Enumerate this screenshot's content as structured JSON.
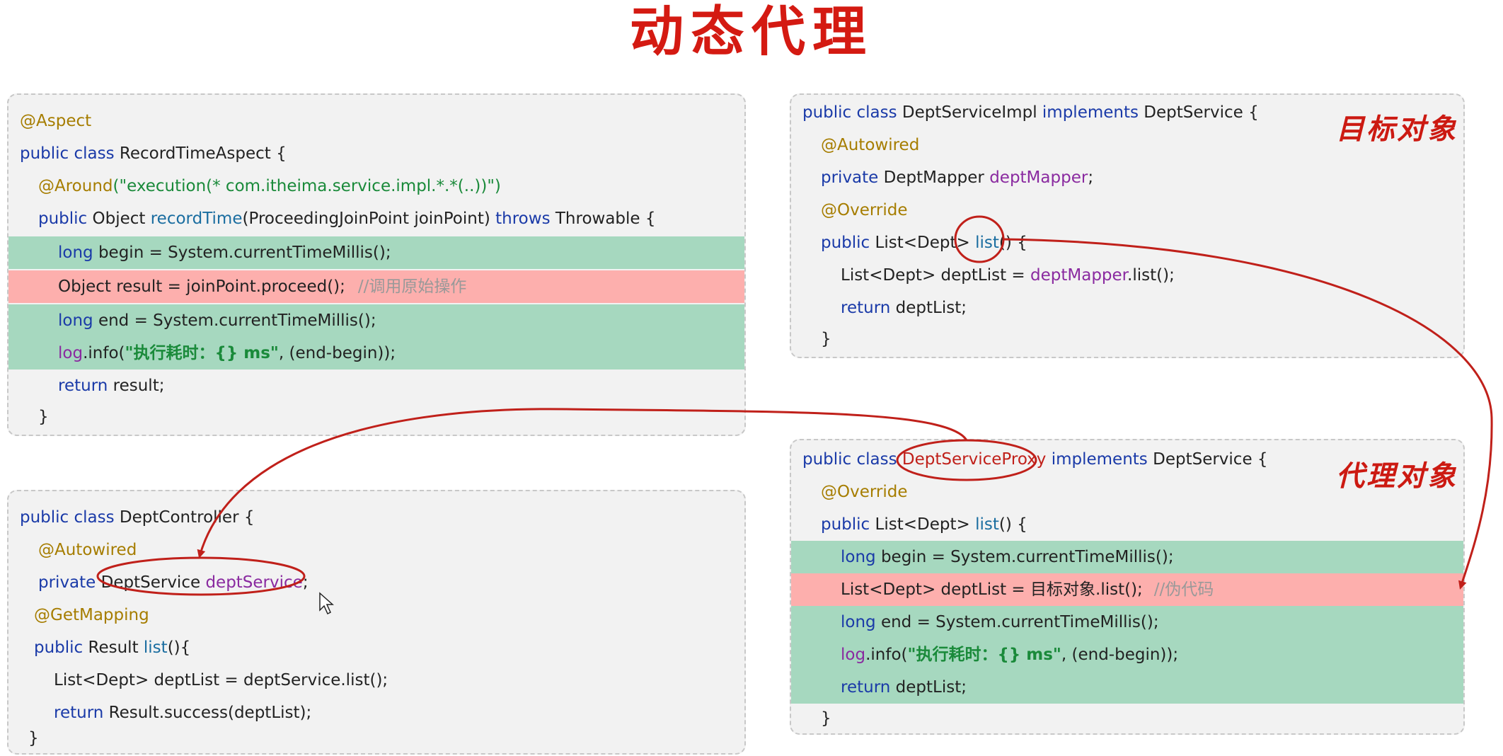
{
  "title": "动态代理",
  "aspect": {
    "line1": "@Aspect",
    "line2_kw": "public class ",
    "line2_name": "RecordTimeAspect {",
    "line3_ann": "@Around",
    "line3_str": "(\"execution(* com.itheima.service.impl.*.*(..))\")",
    "line4_kw1": "public ",
    "line4_type": "Object ",
    "line4_method": "recordTime",
    "line4_params": "(ProceedingJoinPoint joinPoint) ",
    "line4_kw2": "throws ",
    "line4_rest": "Throwable {",
    "line5_kw": "long ",
    "line5_rest": "begin = System.currentTimeMillis();",
    "line6_code": "Object result = joinPoint.proceed();",
    "line6_comment": "//调用原始操作",
    "line7_kw": "long ",
    "line7_rest": "end = System.currentTimeMillis();",
    "line8_fld": "log",
    "line8_a": ".info(",
    "line8_str": "\"执行耗时：{} ms\"",
    "line8_b": ", (end-begin));",
    "line9_kw": "return ",
    "line9_rest": "result;",
    "line10": "}"
  },
  "controller": {
    "line1_kw": "public class ",
    "line1_rest": "DeptController {",
    "line2": "@Autowired",
    "line3_kw": "private ",
    "line3_type": "DeptService ",
    "line3_fld": "deptService",
    "line3_end": ";",
    "line4": "@GetMapping",
    "line5_kw": "public ",
    "line5_type": "Result ",
    "line5_method": "list",
    "line5_end": "(){",
    "line6": "List<Dept> deptList = deptService.list();",
    "line7_kw": "return ",
    "line7_rest": "Result.success(deptList);",
    "line8": "}"
  },
  "impl": {
    "tag": "目标对象",
    "line1_kw": "public class ",
    "line1_name": "DeptServiceImpl ",
    "line1_kw2": "implements ",
    "line1_rest": "DeptService {",
    "line2": "@Autowired",
    "line3_kw": "private ",
    "line3_type": "DeptMapper ",
    "line3_fld": "deptMapper",
    "line3_end": ";",
    "line4": "@Override",
    "line5_kw": "public ",
    "line5_type": "List<Dept> ",
    "line5_method": "list",
    "line5_end": "() {",
    "line6_a": "List<Dept> deptList = ",
    "line6_fld": "deptMapper",
    "line6_b": ".list();",
    "line7_kw": "return ",
    "line7_rest": "deptList;",
    "line8": "}"
  },
  "proxy": {
    "tag": "代理对象",
    "line1_kw": "public class ",
    "line1_name": "DeptServiceProxy ",
    "line1_kw2": "implements ",
    "line1_rest": "DeptService {",
    "line2": "@Override",
    "line3_kw": "public ",
    "line3_type": "List<Dept> ",
    "line3_method": "list",
    "line3_end": "() {",
    "line4_kw": "long ",
    "line4_rest": "begin = System.currentTimeMillis();",
    "line5_code": "List<Dept> deptList = 目标对象.list();",
    "line5_comment": "//伪代码",
    "line6_kw": "long ",
    "line6_rest": "end = System.currentTimeMillis();",
    "line7_fld": "log",
    "line7_a": ".info(",
    "line7_str": "\"执行耗时：{} ms\"",
    "line7_b": ", (end-begin));",
    "line8_kw": "return ",
    "line8_rest": "deptList;",
    "line9": "}"
  },
  "colors": {
    "title": "#d41a12",
    "keyword": "#1a3aa8",
    "annotation": "#a67d00",
    "string": "#1a8a3a",
    "field": "#8a2aa0",
    "highlight_green": "#a6d8bf",
    "highlight_red": "#fdafad",
    "arrow": "#c0201a"
  }
}
